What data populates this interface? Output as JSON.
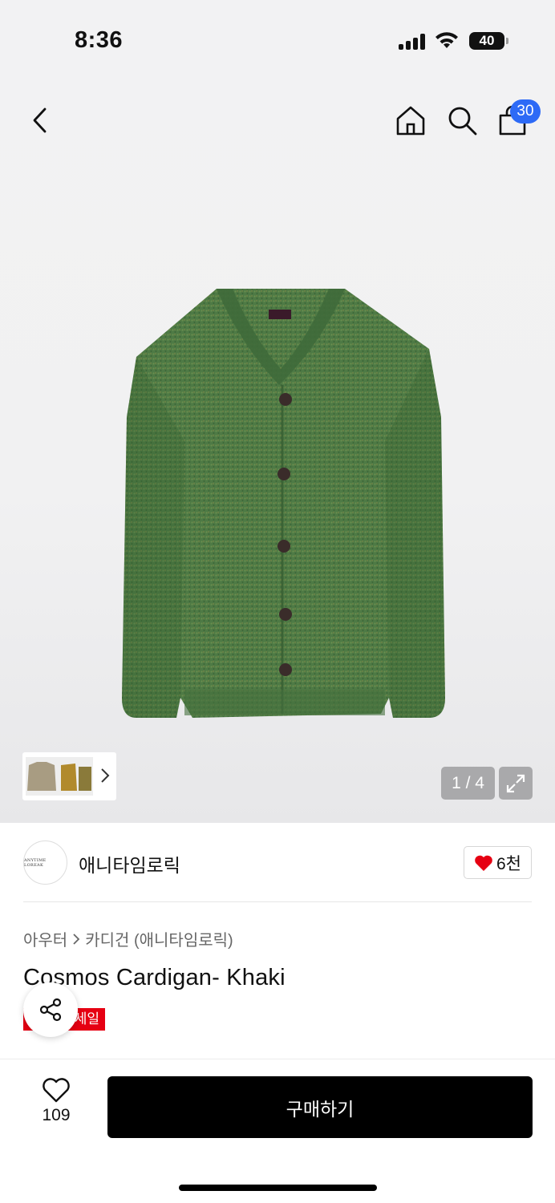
{
  "status_bar": {
    "time": "8:36",
    "battery": "40"
  },
  "nav": {
    "cart_count": "30"
  },
  "gallery": {
    "counter": "1 / 4"
  },
  "brand": {
    "logo_text": "ANYTIME LOREAK",
    "name": "애니타임로릭",
    "likes": "6천"
  },
  "product": {
    "breadcrumb": [
      "아우터",
      "카디건 (애니타임로릭)"
    ],
    "title": "Cosmos Cardigan- Khaki",
    "sale_badge": "세일"
  },
  "bottom_bar": {
    "wish_count": "109",
    "buy_label": "구매하기"
  },
  "colors": {
    "accent_blue": "#2d6af6",
    "sale_red": "#e60012",
    "heart_red": "#e60012",
    "buy_black": "#000000"
  },
  "icons": [
    "back-icon",
    "home-icon",
    "search-icon",
    "cart-icon",
    "chevron-right-icon",
    "expand-icon",
    "heart-icon",
    "share-icon"
  ]
}
